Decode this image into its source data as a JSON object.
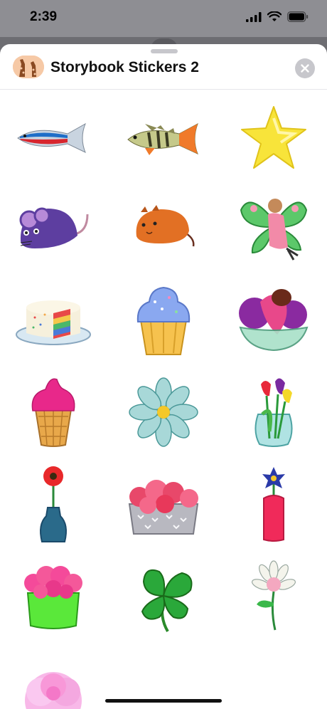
{
  "status": {
    "time": "2:39",
    "icons": [
      "signal-icon",
      "wifi-icon",
      "battery-icon"
    ]
  },
  "sheet": {
    "title": "Storybook Stickers 2",
    "app_icon": "giraffe-app-icon",
    "close_icon": "close-icon"
  },
  "stickers": [
    {
      "name": "sticker-neon-tetra"
    },
    {
      "name": "sticker-perch-fish"
    },
    {
      "name": "sticker-yellow-star"
    },
    {
      "name": "sticker-purple-mouse"
    },
    {
      "name": "sticker-orange-hamster"
    },
    {
      "name": "sticker-fairy"
    },
    {
      "name": "sticker-rainbow-cake"
    },
    {
      "name": "sticker-cupcake"
    },
    {
      "name": "sticker-ice-cream-bowl"
    },
    {
      "name": "sticker-ice-cream-cone"
    },
    {
      "name": "sticker-daisy"
    },
    {
      "name": "sticker-tulip-vase"
    },
    {
      "name": "sticker-gerbera-vase"
    },
    {
      "name": "sticker-rose-box"
    },
    {
      "name": "sticker-blue-flower-vase"
    },
    {
      "name": "sticker-flower-pot"
    },
    {
      "name": "sticker-clover"
    },
    {
      "name": "sticker-clover-flower"
    },
    {
      "name": "sticker-pink-rose"
    }
  ]
}
